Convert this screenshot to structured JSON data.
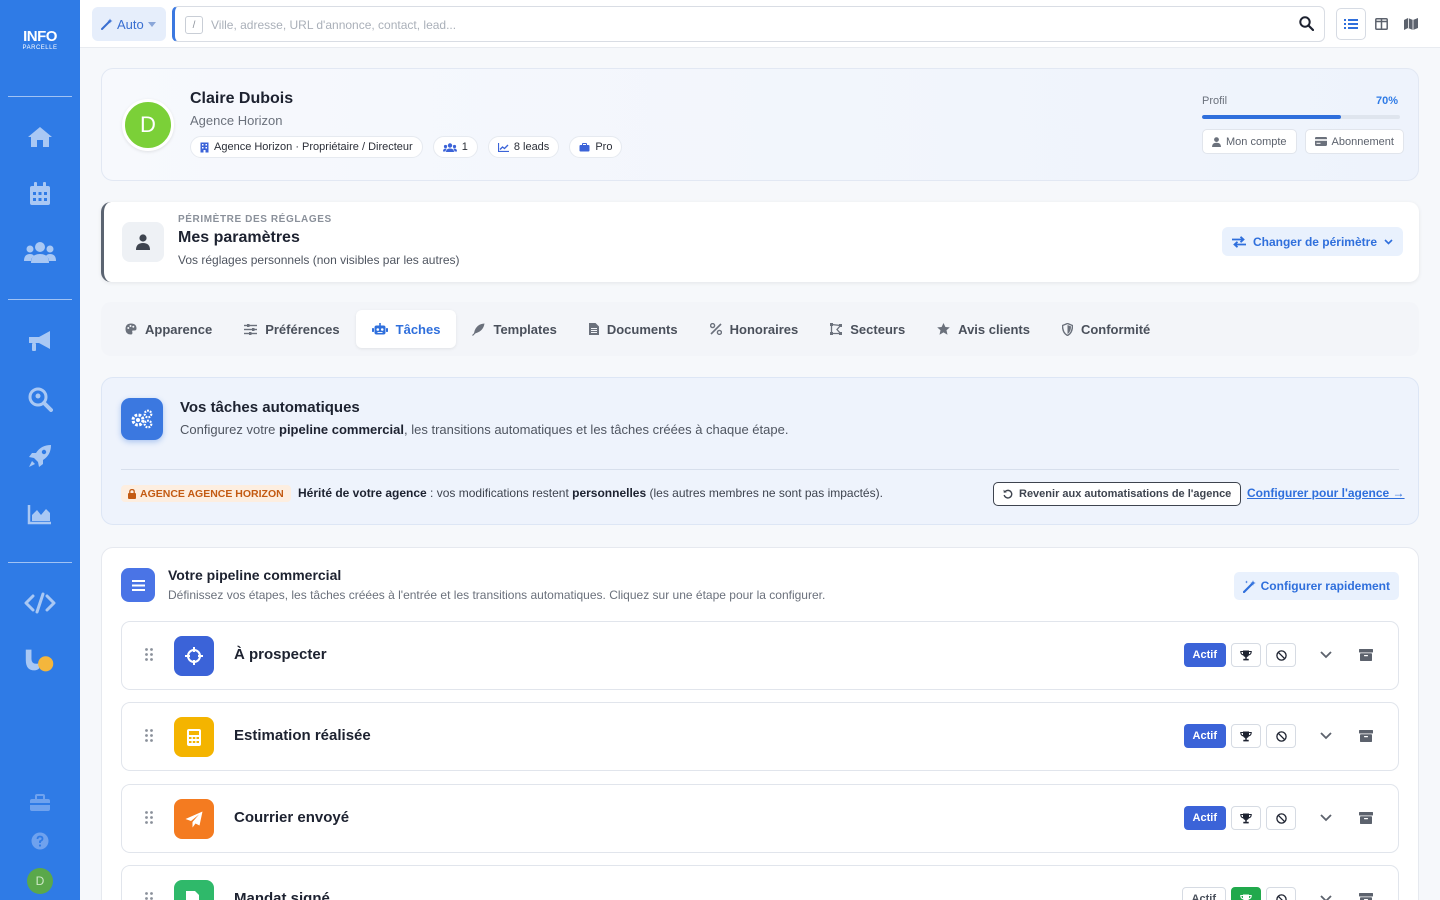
{
  "colors": {
    "brand": "#2f7be6",
    "accent": "#3b63d8",
    "orange_badge": "#c35a12",
    "won_green": "#21a94c"
  },
  "logo": {
    "line1": "INFO",
    "line2": "PARCELLE"
  },
  "sidebar": {
    "items": [
      {
        "icon": "home-icon"
      },
      {
        "icon": "calendar-icon"
      },
      {
        "icon": "users-icon"
      },
      {
        "icon": "megaphone-icon"
      },
      {
        "icon": "search-location-icon"
      },
      {
        "icon": "rocket-icon"
      },
      {
        "icon": "chart-area-icon"
      },
      {
        "icon": "code-icon"
      },
      {
        "icon": "magnet-icon"
      },
      {
        "icon": "toolbox-icon"
      },
      {
        "icon": "help-icon"
      }
    ],
    "user_initial": "D"
  },
  "topbar": {
    "mode_label": "Auto",
    "slash_key": "/",
    "search_placeholder": "Ville, adresse, URL d'annonce, contact, lead...",
    "views": [
      "list-view-icon",
      "columns-view-icon",
      "map-view-icon"
    ]
  },
  "profile": {
    "initial": "D",
    "name": "Claire Dubois",
    "agency": "Agence Horizon",
    "badges": {
      "role": "Agence Horizon · Propriétaire / Directeur",
      "members": "1",
      "leads": "8 leads",
      "plan": "Pro"
    },
    "progress_label": "Profil",
    "progress_pct_label": "70%",
    "progress_value": 0.7,
    "account_button": "Mon compte",
    "subscription_button": "Abonnement"
  },
  "scope": {
    "eyebrow": "PÉRIMÈTRE DES RÉGLAGES",
    "title": "Mes paramètres",
    "subtitle": "Vos réglages personnels (non visibles par les autres)",
    "change_button": "Changer de périmètre"
  },
  "tabs": [
    {
      "label": "Apparence",
      "icon": "palette-icon",
      "active": false
    },
    {
      "label": "Préférences",
      "icon": "sliders-icon",
      "active": false
    },
    {
      "label": "Tâches",
      "icon": "robot-icon",
      "active": true
    },
    {
      "label": "Templates",
      "icon": "feather-icon",
      "active": false
    },
    {
      "label": "Documents",
      "icon": "file-icon",
      "active": false
    },
    {
      "label": "Honoraires",
      "icon": "percent-icon",
      "active": false
    },
    {
      "label": "Secteurs",
      "icon": "draw-polygon-icon",
      "active": false
    },
    {
      "label": "Avis clients",
      "icon": "star-icon",
      "active": false
    },
    {
      "label": "Conformité",
      "icon": "shield-icon",
      "active": false
    }
  ],
  "automation": {
    "title": "Vos tâches automatiques",
    "sub_prefix": "Configurez votre ",
    "sub_bold": "pipeline commercial",
    "sub_suffix": ", les transitions automatiques et les tâches créées à chaque étape.",
    "inherited_badge": "AGENCE AGENCE HORIZON",
    "inh_bold1": "Hérité de votre agence",
    "inh_mid": " : vos modifications restent ",
    "inh_bold2": "personnelles",
    "inh_end": " (les autres membres ne sont pas impactés).",
    "revert_button": "Revenir aux automatisations de l'agence",
    "configure_link": "Configurer pour l'agence →"
  },
  "pipeline": {
    "title": "Votre pipeline commercial",
    "subtitle": "Définissez vos étapes, les tâches créées à l'entrée et les transitions automatiques. Cliquez sur une étape pour la configurer.",
    "quick_button": "Configurer rapidement",
    "stages": [
      {
        "name": "À prospecter",
        "icon": "crosshairs-icon",
        "color": "#3b63d8",
        "status": "Actif",
        "active": true,
        "won": false
      },
      {
        "name": "Estimation réalisée",
        "icon": "calculator-icon",
        "color": "#f4b400",
        "status": "Actif",
        "active": true,
        "won": false
      },
      {
        "name": "Courrier envoyé",
        "icon": "paper-plane-icon",
        "color": "#f47b20",
        "status": "Actif",
        "active": true,
        "won": false
      },
      {
        "name": "Mandat signé",
        "icon": "file-signature-icon",
        "color": "#2fb96a",
        "status": "Actif",
        "active": false,
        "won": true
      }
    ]
  }
}
